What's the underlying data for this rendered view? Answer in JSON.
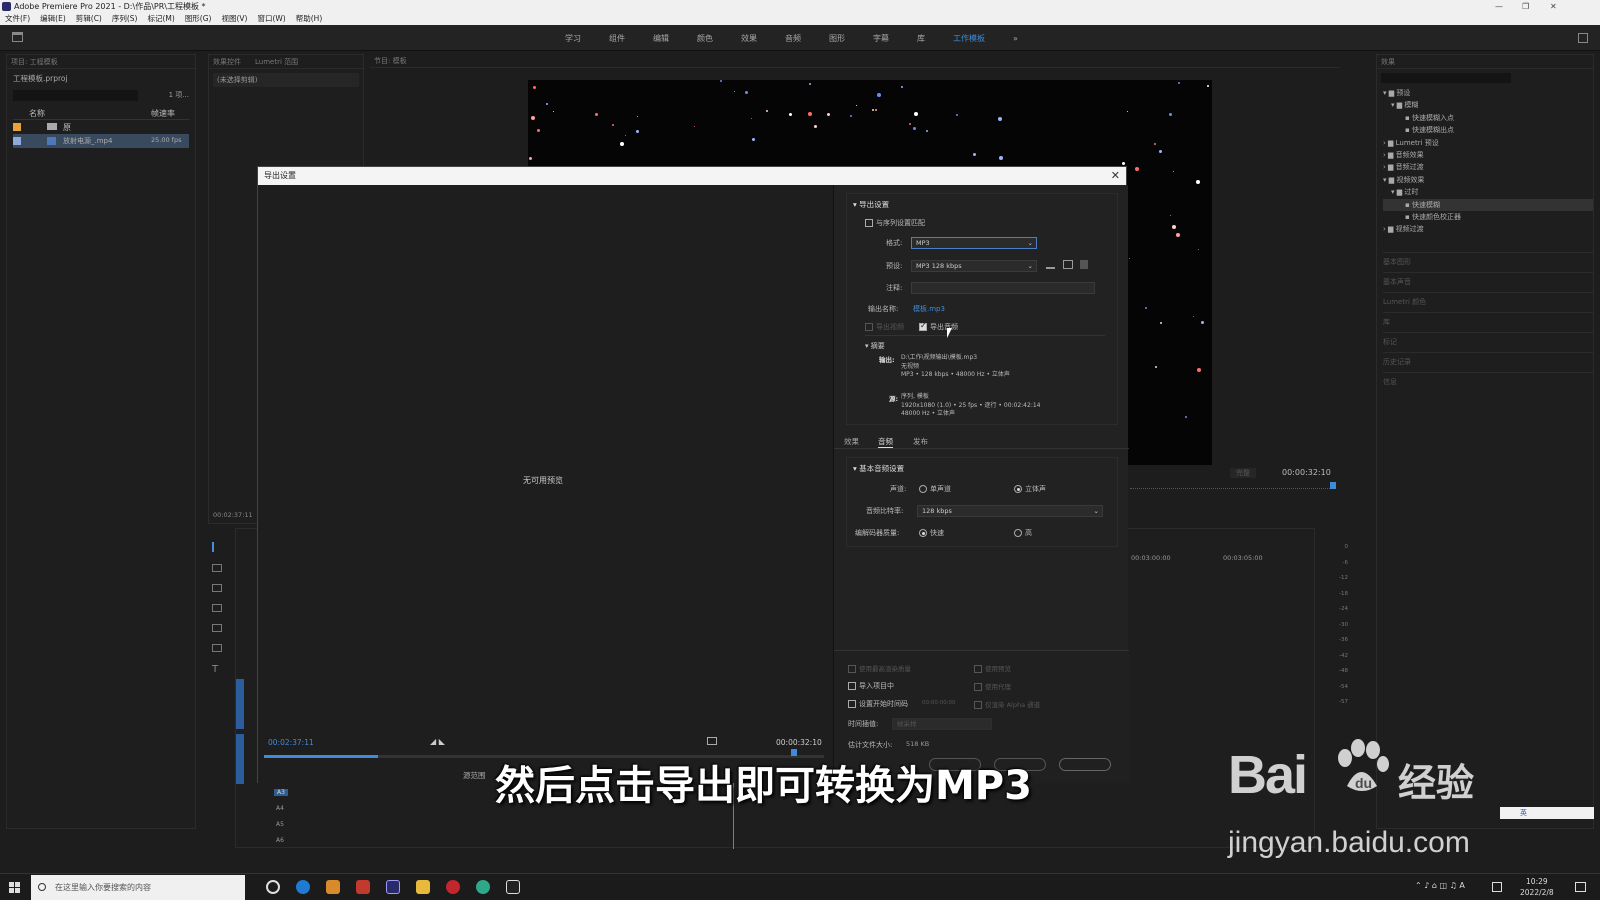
{
  "window": {
    "title": "Adobe Premiere Pro 2021 - D:\\作品\\PR\\工程模板 *",
    "minimize": "—",
    "maximize": "❐",
    "close": "✕"
  },
  "menu": [
    "文件(F)",
    "编辑(E)",
    "剪辑(C)",
    "序列(S)",
    "标记(M)",
    "图形(G)",
    "视图(V)",
    "窗口(W)",
    "帮助(H)"
  ],
  "workspaces": [
    "学习",
    "组件",
    "编辑",
    "颜色",
    "效果",
    "音频",
    "图形",
    "字幕",
    "库",
    "工作模板"
  ],
  "workspaces_more": "»",
  "project": {
    "header": "项目: 工程模板",
    "file": "工程模板.prproj",
    "count": "1 项...",
    "col_name": "名称",
    "col_rate": "帧速率",
    "items": [
      {
        "name": "原",
        "rate": ""
      },
      {
        "name": "放射电源_.mp4",
        "rate": "25.00 fps"
      }
    ]
  },
  "effect_controls": {
    "tab1": "效果控件",
    "tab2": "Lumetri 范围",
    "no_clip": "(未选择剪辑)",
    "timecode": "00:02:37:11"
  },
  "program": {
    "header": "节目: 模板",
    "timecode_right": "00:00:32:10",
    "fit": "完整"
  },
  "timeline": {
    "ruler1": "00:03:00:00",
    "ruler2": "00:03:05:00",
    "tracks": [
      "A3",
      "A4",
      "A5",
      "A6"
    ]
  },
  "effects_panel": {
    "header": "效果",
    "tree": [
      "预设",
      "模糊",
      "快速模糊入点",
      "快速模糊出点",
      "Lumetri 预设",
      "音频效果",
      "音频过渡",
      "视频效果",
      "过时",
      "快速模糊",
      "快速颜色校正器",
      "视频过渡"
    ],
    "collapsed": [
      "基本图形",
      "基本声音",
      "Lumetri 颜色",
      "库",
      "标记",
      "历史记录",
      "信息"
    ]
  },
  "meter": {
    "scale": [
      "0",
      "-6",
      "-12",
      "-18",
      "-24",
      "-30",
      "-36",
      "-42",
      "-48",
      "-54",
      "-57"
    ]
  },
  "dialog": {
    "title": "导出设置",
    "close": "✕",
    "preview": {
      "no_preview": "无可用预览",
      "tc_left": "00:02:37:11",
      "tc_right": "00:00:32:10",
      "range_label": "源范围"
    },
    "export_settings": {
      "section": "导出设置",
      "match_sequence": "与序列设置匹配",
      "format_label": "格式:",
      "format_value": "MP3",
      "preset_label": "预设:",
      "preset_value": "MP3 128 kbps",
      "comments_label": "注释:",
      "output_name_label": "输出名称:",
      "output_name_value": "模板.mp3",
      "export_video": "导出视频",
      "export_audio": "导出音频"
    },
    "summary": {
      "section": "摘要",
      "output_label": "输出:",
      "output_lines": [
        "D:\\工作\\视频输出\\模板.mp3",
        "无视频",
        "MP3 • 128 kbps • 48000 Hz • 立体声"
      ],
      "source_label": "源:",
      "source_lines": [
        "序列, 模板",
        "1920x1080 (1.0) • 25 fps • 逐行 • 00:02:42:14",
        "48000 Hz • 立体声"
      ]
    },
    "tabs": [
      "效果",
      "音频",
      "发布"
    ],
    "audio": {
      "section": "基本音频设置",
      "channels_label": "声道:",
      "mono": "单声道",
      "stereo": "立体声",
      "bitrate_label": "音频比特率:",
      "bitrate_value": "128 kbps",
      "encoder_label": "编解码器质量:",
      "fast": "快速",
      "high": "高"
    },
    "bottom": {
      "max_render": "使用最高渲染质量",
      "use_previews": "使用预览",
      "import_project": "导入项目中",
      "use_proxies": "使用代理",
      "set_start_tc": "设置开始时间码",
      "start_tc": "00:00:00:00",
      "render_alpha": "仅渲染 Alpha 通道",
      "interp_label": "时间插值:",
      "interp_value": "帧采样",
      "size_label": "估计文件大小:",
      "size_value": "518 KB"
    }
  },
  "subtitle": "然后点击导出即可转换为MP3",
  "watermark": {
    "brand": "Bai",
    "brand2": "经验",
    "url": "jingyan.baidu.com"
  },
  "taskbar": {
    "search": "在这里输入你要搜索的内容",
    "time": "10:29",
    "date": "2022/2/8",
    "ime": "英"
  },
  "colors": {
    "accent": "#3e8bd9",
    "panel": "#1e1e1e",
    "dialog_title": "#f4f4f4"
  }
}
